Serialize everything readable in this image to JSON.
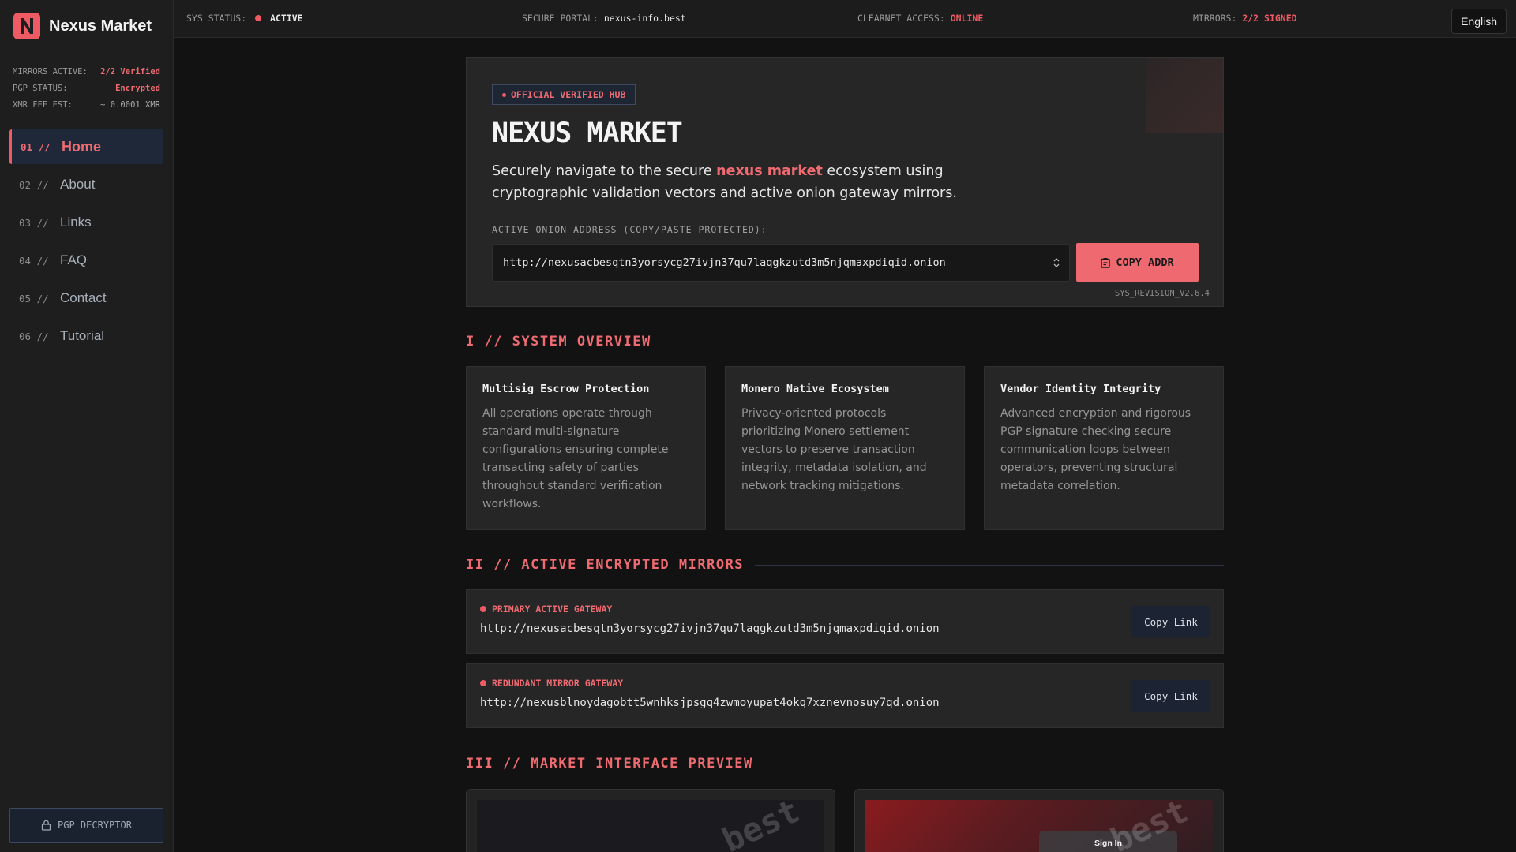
{
  "app": {
    "name": "Nexus Market",
    "logo_letter": "N",
    "accent_color": "#ef5b64"
  },
  "sidebar": {
    "stats": [
      {
        "label": "MIRRORS ACTIVE:",
        "value": "2/2 Verified"
      },
      {
        "label": "PGP STATUS:",
        "value": "Encrypted"
      },
      {
        "label": "XMR FEE EST:",
        "value": "~ 0.0001 XMR"
      }
    ],
    "nav": [
      {
        "num": "01 //",
        "label": "Home",
        "active": true
      },
      {
        "num": "02 //",
        "label": "About"
      },
      {
        "num": "03 //",
        "label": "Links"
      },
      {
        "num": "04 //",
        "label": "FAQ"
      },
      {
        "num": "05 //",
        "label": "Contact"
      },
      {
        "num": "06 //",
        "label": "Tutorial"
      }
    ],
    "pgp_button": "PGP DECRYPTOR"
  },
  "topbar": {
    "sys_status_label": "SYS STATUS:",
    "sys_status_value": "ACTIVE",
    "portal_label": "SECURE PORTAL:",
    "portal_value": "nexus-info.best",
    "clearnet_label": "CLEARNET ACCESS:",
    "clearnet_value": "ONLINE",
    "mirrors_label": "MIRRORS:",
    "mirrors_value": "2/2 SIGNED",
    "language": "English"
  },
  "hero": {
    "badge": "OFFICIAL VERIFIED HUB",
    "title": "NEXUS MARKET",
    "desc_before": "Securely navigate to the secure ",
    "desc_highlight": "nexus market",
    "desc_after": " ecosystem using cryptographic validation vectors and active onion gateway mirrors.",
    "address_label": "ACTIVE ONION ADDRESS (COPY/PASTE PROTECTED):",
    "address_value": "http://nexusacbesqtn3yorsycg27ivjn37qu7laqgkzutd3m5njqmaxpdiqid.onion",
    "copy_button": "COPY ADDR",
    "revision": "SYS_REVISION_V2.6.4"
  },
  "overview": {
    "title": "I // SYSTEM OVERVIEW",
    "cards": [
      {
        "title": "Multisig Escrow Protection",
        "text": "All operations operate through standard multi-signature configurations ensuring complete transacting safety of parties throughout standard verification workflows."
      },
      {
        "title": "Monero Native Ecosystem",
        "text": "Privacy-oriented protocols prioritizing Monero settlement vectors to preserve transaction integrity, metadata isolation, and network tracking mitigations."
      },
      {
        "title": "Vendor Identity Integrity",
        "text": "Advanced encryption and rigorous PGP signature checking secure communication loops between operators, preventing structural metadata correlation."
      }
    ]
  },
  "mirrors": {
    "title": "II // ACTIVE ENCRYPTED MIRRORS",
    "items": [
      {
        "label": "PRIMARY ACTIVE GATEWAY",
        "url": "http://nexusacbesqtn3yorsycg27ivjn37qu7laqgkzutd3m5njqmaxpdiqid.onion",
        "button": "Copy Link"
      },
      {
        "label": "REDUNDANT MIRROR GATEWAY",
        "url": "http://nexusblnoydagobtt5wnhksjpsgq4zwmoyupat4okq7xznevnosuy7qd.onion",
        "button": "Copy Link"
      }
    ]
  },
  "preview": {
    "title": "III // MARKET INTERFACE PREVIEW",
    "watermark": "best",
    "signin_label": "Sign In"
  }
}
